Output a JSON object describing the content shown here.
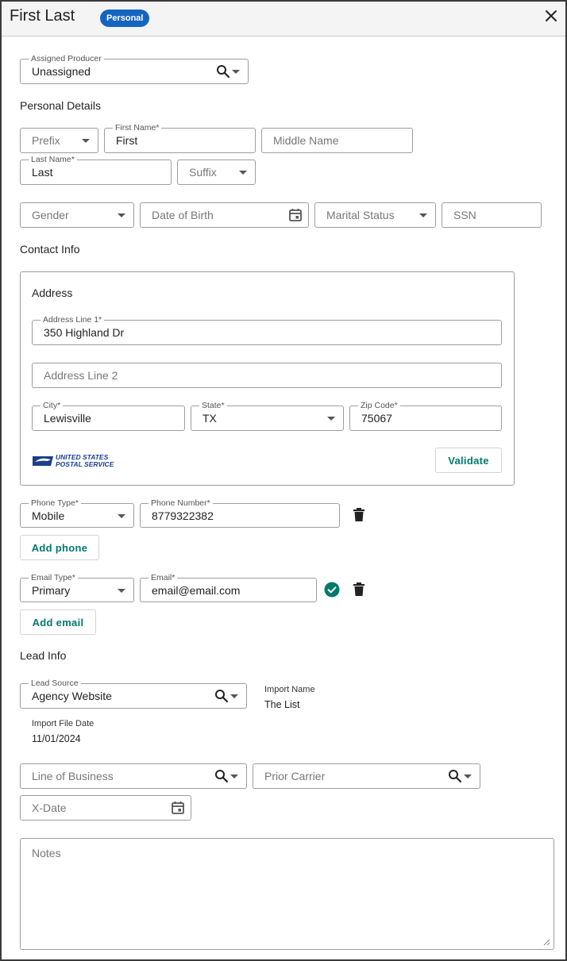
{
  "header": {
    "title": "First Last",
    "badge": "Personal"
  },
  "producer": {
    "label": "Assigned Producer",
    "value": "Unassigned"
  },
  "personal": {
    "heading": "Personal Details",
    "prefix_placeholder": "Prefix",
    "first_name_label": "First Name*",
    "first_name_value": "First",
    "middle_name_placeholder": "Middle Name",
    "last_name_label": "Last Name*",
    "last_name_value": "Last",
    "suffix_placeholder": "Suffix",
    "gender_placeholder": "Gender",
    "dob_placeholder": "Date of Birth",
    "marital_placeholder": "Marital Status",
    "ssn_placeholder": "SSN"
  },
  "contact": {
    "heading": "Contact Info",
    "address": {
      "heading": "Address",
      "line1_label": "Address Line 1*",
      "line1_value": "350 Highland Dr",
      "line2_placeholder": "Address Line 2",
      "city_label": "City*",
      "city_value": "Lewisville",
      "state_label": "State*",
      "state_value": "TX",
      "zip_label": "Zip Code*",
      "zip_value": "75067",
      "usps_line1": "UNITED STATES",
      "usps_line2": "POSTAL SERVICE",
      "validate_label": "Validate"
    },
    "phone": {
      "type_label": "Phone Type*",
      "type_value": "Mobile",
      "number_label": "Phone Number*",
      "number_value": "8779322382",
      "add_label": "Add phone"
    },
    "email": {
      "type_label": "Email Type*",
      "type_value": "Primary",
      "email_label": "Email*",
      "email_value": "email@email.com",
      "add_label": "Add email"
    }
  },
  "lead": {
    "heading": "Lead Info",
    "source_label": "Lead Source",
    "source_value": "Agency Website",
    "import_name_label": "Import Name",
    "import_name_value": "The List",
    "import_date_label": "Import File Date",
    "import_date_value": "11/01/2024",
    "lob_placeholder": "Line of Business",
    "prior_carrier_placeholder": "Prior Carrier",
    "xdate_placeholder": "X-Date",
    "notes_placeholder": "Notes"
  },
  "colors": {
    "badge": "#1565c0",
    "accent": "#00796b",
    "check": "#00796b"
  }
}
